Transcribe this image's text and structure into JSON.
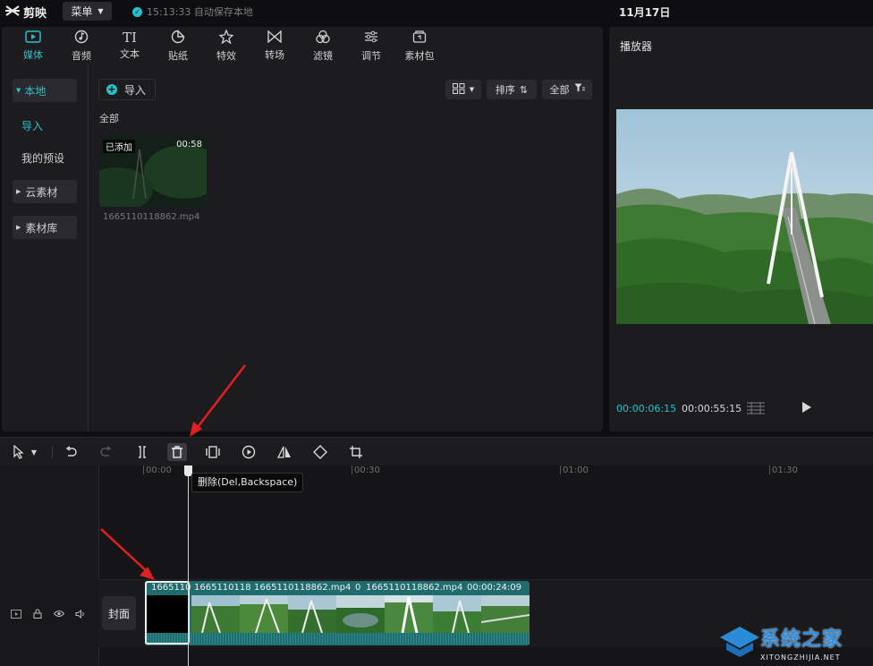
{
  "app": {
    "name": "剪映",
    "menu_label": "菜单",
    "autosave": "15:13:33 自动保存本地",
    "date": "11月17日"
  },
  "media_tabs": [
    {
      "label": "媒体",
      "icon": "media-icon"
    },
    {
      "label": "音频",
      "icon": "audio-icon"
    },
    {
      "label": "文本",
      "icon": "text-icon"
    },
    {
      "label": "贴纸",
      "icon": "sticker-icon"
    },
    {
      "label": "特效",
      "icon": "effects-icon"
    },
    {
      "label": "转场",
      "icon": "transition-icon"
    },
    {
      "label": "滤镜",
      "icon": "filter-icon"
    },
    {
      "label": "调节",
      "icon": "adjust-icon"
    },
    {
      "label": "素材包",
      "icon": "material-pack-icon"
    }
  ],
  "sidebar": {
    "local": "本地",
    "import": "导入",
    "presets": "我的预设",
    "cloud": "云素材",
    "library": "素材库"
  },
  "media": {
    "import_label": "导入",
    "sort_label": "排序",
    "filter_label": "全部",
    "all_heading": "全部",
    "item": {
      "badge": "已添加",
      "duration": "00:58",
      "filename": "1665110118862.mp4"
    }
  },
  "player": {
    "title": "播放器",
    "current_time": "00:00:06:15",
    "total_time": "00:00:55:15"
  },
  "timeline": {
    "ruler": [
      "00:00",
      "00:30",
      "01:00",
      "01:30"
    ],
    "tooltip": "删除(Del,Backspace)",
    "cover_label": "封面",
    "clip_labels": [
      "1665110",
      "1665110118",
      "1665110118862.mp4",
      "0",
      "1665110118862.mp4",
      "00:00:24:09"
    ]
  },
  "watermark": {
    "text": "系统之家",
    "sub": "XITONGZHIJIA.NET"
  },
  "colors": {
    "accent": "#25c2cc",
    "clip": "#1f6b6e",
    "panel": "#1c1c1f",
    "arrow": "#e02020"
  }
}
